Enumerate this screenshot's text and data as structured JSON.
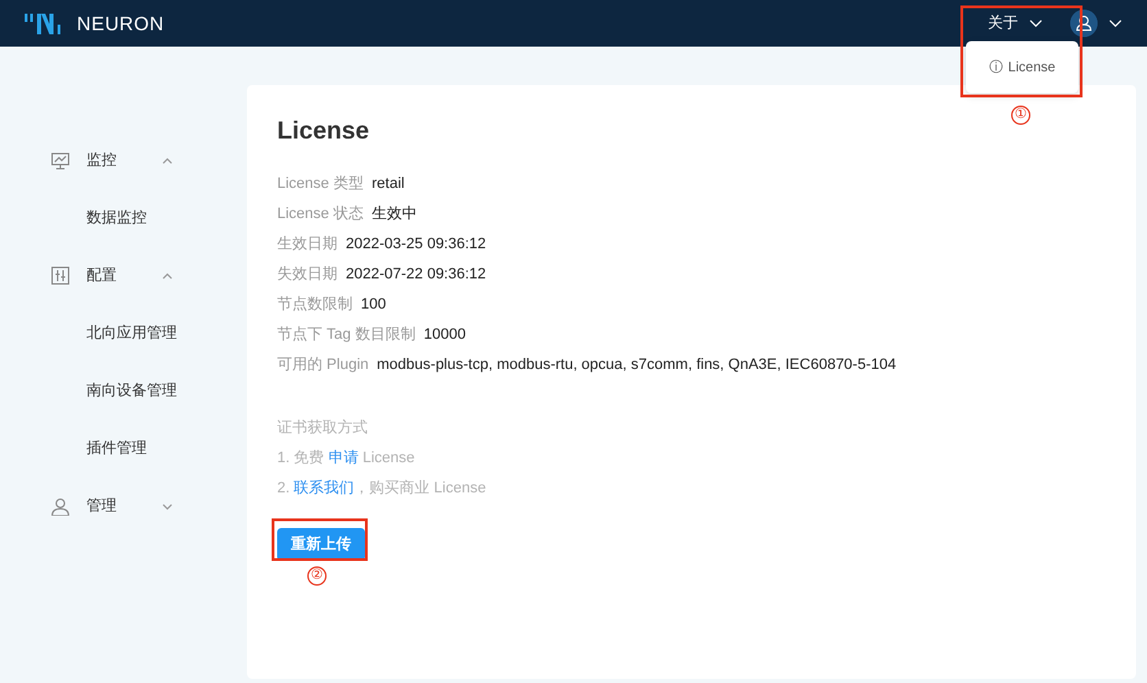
{
  "header": {
    "logo_text": "NEURON",
    "about_menu": {
      "label": "关于",
      "expanded": true,
      "items": [
        {
          "icon_char": "ⓘ",
          "label": "License"
        }
      ]
    }
  },
  "sidebar": {
    "items": [
      {
        "label": "监控",
        "expanded": true,
        "children": [
          {
            "label": "数据监控"
          }
        ]
      },
      {
        "label": "配置",
        "expanded": true,
        "children": [
          {
            "label": "北向应用管理"
          },
          {
            "label": "南向设备管理"
          },
          {
            "label": "插件管理"
          }
        ]
      },
      {
        "label": "管理",
        "expanded": false
      }
    ]
  },
  "license": {
    "title": "License",
    "fields": [
      {
        "label": "License 类型",
        "value": "retail"
      },
      {
        "label": "License 状态",
        "value": "生效中"
      },
      {
        "label": "生效日期",
        "value": "2022-03-25 09:36:12"
      },
      {
        "label": "失效日期",
        "value": "2022-07-22 09:36:12"
      },
      {
        "label": "节点数限制",
        "value": "100"
      },
      {
        "label": "节点下 Tag 数目限制",
        "value": "10000"
      },
      {
        "label": "可用的 Plugin",
        "value": "modbus-plus-tcp, modbus-rtu, opcua, s7comm, fins, QnA3E, IEC60870-5-104"
      }
    ],
    "howto_title": "证书获取方式",
    "howto_lines": [
      {
        "prefix": "1. 免费 ",
        "link": "申请",
        "suffix": " License"
      },
      {
        "prefix": "2. ",
        "link": "联系我们",
        "suffix": "，购买商业 License"
      }
    ],
    "upload_button": "重新上传"
  },
  "annotations": [
    {
      "number": "①"
    },
    {
      "number": "②"
    }
  ]
}
